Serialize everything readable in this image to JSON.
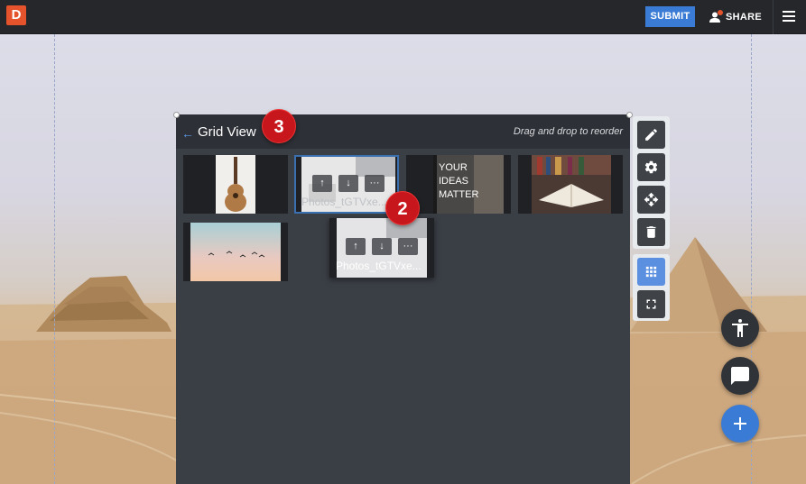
{
  "app": {
    "logo_letter": "D"
  },
  "topbar": {
    "submit_label": "SUBMIT",
    "share_label": "SHARE"
  },
  "panel": {
    "title": "Grid View",
    "hint": "Drag and drop to reorder"
  },
  "tiles": [
    {
      "name": "ukulele-photo"
    },
    {
      "name": "Photos_tGTVxe..."
    },
    {
      "name": "ideas-photo",
      "lines": [
        "YOUR",
        "IDEAS",
        "MATTER"
      ]
    },
    {
      "name": "books-photo"
    },
    {
      "name": "birds-sky-photo"
    }
  ],
  "dragging_tile": {
    "name": "Photos_tGTVxe..."
  },
  "tile_controls": {
    "up": "↑",
    "down": "↓",
    "more": "···"
  },
  "badges": {
    "first": "3",
    "second": "2"
  },
  "toolbar": {
    "icons": [
      "pencil-icon",
      "gear-icon",
      "move-icon",
      "trash-icon",
      "grid-icon",
      "fullscreen-icon"
    ]
  },
  "colors": {
    "accent": "#3a7bd5",
    "logo": "#e5532d",
    "badge": "#c8161d",
    "panel": "#3a3e45"
  }
}
